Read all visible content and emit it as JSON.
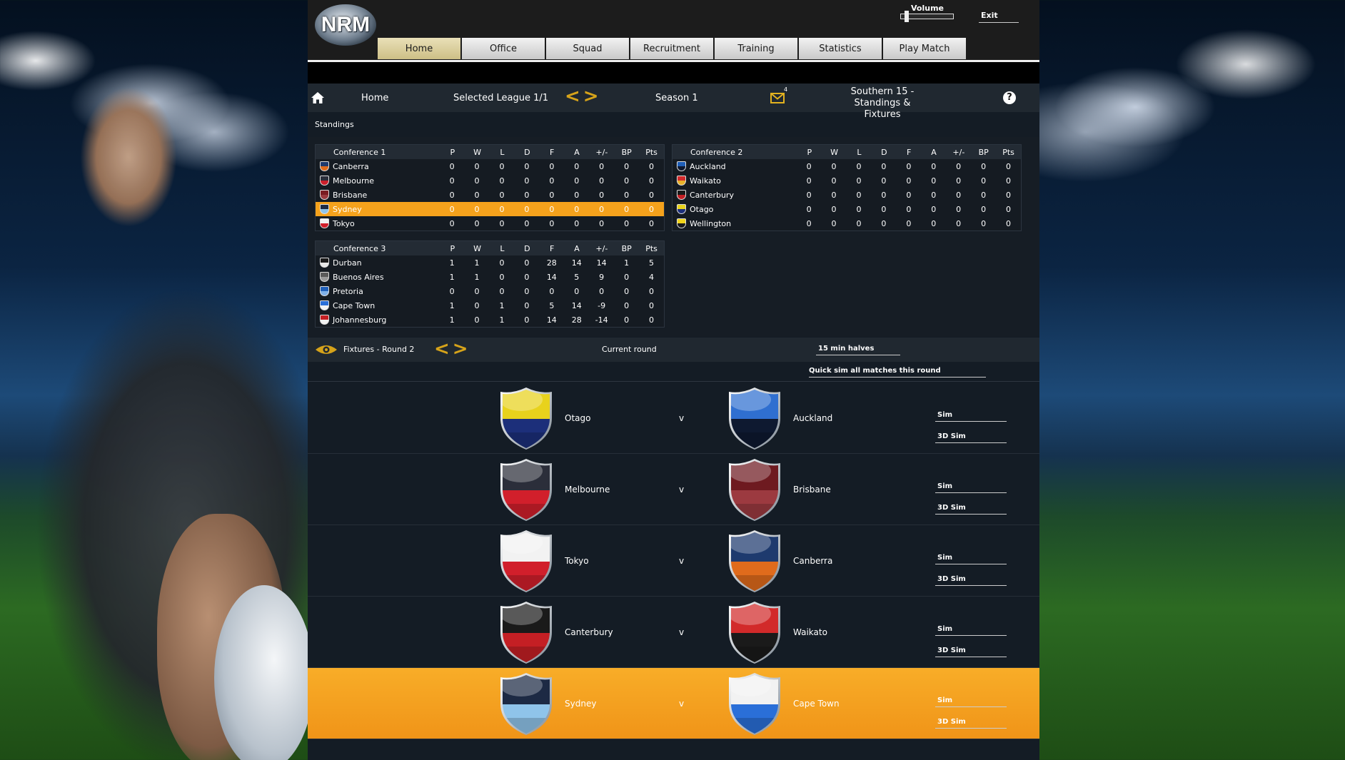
{
  "header": {
    "logo_text": "NRM",
    "volume_label": "Volume",
    "volume_level": 0.12,
    "exit_label": "Exit"
  },
  "tabs": [
    {
      "label": "Home",
      "active": true
    },
    {
      "label": "Office",
      "active": false
    },
    {
      "label": "Squad",
      "active": false
    },
    {
      "label": "Recruitment",
      "active": false
    },
    {
      "label": "Training",
      "active": false
    },
    {
      "label": "Statistics",
      "active": false
    },
    {
      "label": "Play Match",
      "active": false
    }
  ],
  "infobar": {
    "home_label": "Home",
    "league_label": "Selected League 1/1",
    "season_label": "Season 1",
    "mail_count": "4",
    "page_title": "Southern 15 - Standings & Fixtures",
    "help_label": "?"
  },
  "standings": {
    "label": "Standings",
    "columns": [
      "P",
      "W",
      "L",
      "D",
      "F",
      "A",
      "+/-",
      "BP",
      "Pts"
    ],
    "conferences": [
      {
        "name": "Conference 1",
        "rows": [
          {
            "team": "Canberra",
            "colors": [
              "#1e3a6e",
              "#e06b1c"
            ],
            "stats": [
              "0",
              "0",
              "0",
              "0",
              "0",
              "0",
              "0",
              "0",
              "0"
            ],
            "highlight": false
          },
          {
            "team": "Melbourne",
            "colors": [
              "#2b2e3a",
              "#cc1f2b"
            ],
            "stats": [
              "0",
              "0",
              "0",
              "0",
              "0",
              "0",
              "0",
              "0",
              "0"
            ],
            "highlight": false
          },
          {
            "team": "Brisbane",
            "colors": [
              "#7a1c22",
              "#9a3a3f"
            ],
            "stats": [
              "0",
              "0",
              "0",
              "0",
              "0",
              "0",
              "0",
              "0",
              "0"
            ],
            "highlight": false
          },
          {
            "team": "Sydney",
            "colors": [
              "#1d2a44",
              "#8fc4ea"
            ],
            "stats": [
              "0",
              "0",
              "0",
              "0",
              "0",
              "0",
              "0",
              "0",
              "0"
            ],
            "highlight": true
          },
          {
            "team": "Tokyo",
            "colors": [
              "#f2f2f2",
              "#d11f2b"
            ],
            "stats": [
              "0",
              "0",
              "0",
              "0",
              "0",
              "0",
              "0",
              "0",
              "0"
            ],
            "highlight": false
          }
        ]
      },
      {
        "name": "Conference 2",
        "rows": [
          {
            "team": "Auckland",
            "colors": [
              "#1f5fb8",
              "#0e1930"
            ],
            "stats": [
              "0",
              "0",
              "0",
              "0",
              "0",
              "0",
              "0",
              "0",
              "0"
            ],
            "highlight": false
          },
          {
            "team": "Waikato",
            "colors": [
              "#d22a2a",
              "#e8b22a"
            ],
            "stats": [
              "0",
              "0",
              "0",
              "0",
              "0",
              "0",
              "0",
              "0",
              "0"
            ],
            "highlight": false
          },
          {
            "team": "Canterbury",
            "colors": [
              "#1a1a1a",
              "#c41f24"
            ],
            "stats": [
              "0",
              "0",
              "0",
              "0",
              "0",
              "0",
              "0",
              "0",
              "0"
            ],
            "highlight": false
          },
          {
            "team": "Otago",
            "colors": [
              "#e8d21c",
              "#1c2f7a"
            ],
            "stats": [
              "0",
              "0",
              "0",
              "0",
              "0",
              "0",
              "0",
              "0",
              "0"
            ],
            "highlight": false
          },
          {
            "team": "Wellington",
            "colors": [
              "#f0d41a",
              "#1a1a1a"
            ],
            "stats": [
              "0",
              "0",
              "0",
              "0",
              "0",
              "0",
              "0",
              "0",
              "0"
            ],
            "highlight": false
          }
        ]
      },
      {
        "name": "Conference 3",
        "rows": [
          {
            "team": "Durban",
            "colors": [
              "#1a1a1a",
              "#e8e8e8"
            ],
            "stats": [
              "1",
              "1",
              "0",
              "0",
              "28",
              "14",
              "14",
              "1",
              "5"
            ],
            "highlight": false
          },
          {
            "team": "Buenos Aires",
            "colors": [
              "#5a5a5a",
              "#9a9a9a"
            ],
            "stats": [
              "1",
              "1",
              "0",
              "0",
              "14",
              "5",
              "9",
              "0",
              "4"
            ],
            "highlight": false
          },
          {
            "team": "Pretoria",
            "colors": [
              "#1f5fb8",
              "#7fb0e8"
            ],
            "stats": [
              "0",
              "0",
              "0",
              "0",
              "0",
              "0",
              "0",
              "0",
              "0"
            ],
            "highlight": false
          },
          {
            "team": "Cape Town",
            "colors": [
              "#2a6fd8",
              "#f2f2f2"
            ],
            "stats": [
              "1",
              "0",
              "1",
              "0",
              "5",
              "14",
              "-9",
              "0",
              "0"
            ],
            "highlight": false
          },
          {
            "team": "Johannesburg",
            "colors": [
              "#c41f24",
              "#f2f2f2"
            ],
            "stats": [
              "1",
              "0",
              "1",
              "0",
              "14",
              "28",
              "-14",
              "0",
              "0"
            ],
            "highlight": false
          }
        ]
      }
    ]
  },
  "fixtures": {
    "label": "Fixtures - Round 2",
    "current_round_label": "Current round",
    "halves_label": "15 min halves",
    "quick_sim_label": "Quick sim all matches this round",
    "vs_label": "v",
    "sim_label": "Sim",
    "sim3d_label": "3D Sim",
    "matches": [
      {
        "home": "Otago",
        "away": "Auckland",
        "home_colors": [
          "#e8d21c",
          "#1c2f7a"
        ],
        "away_colors": [
          "#2f6fd0",
          "#0e1930"
        ],
        "highlight": false
      },
      {
        "home": "Melbourne",
        "away": "Brisbane",
        "home_colors": [
          "#2b2e3a",
          "#d11f2b"
        ],
        "away_colors": [
          "#6e1a20",
          "#9c3a40"
        ],
        "highlight": false
      },
      {
        "home": "Tokyo",
        "away": "Canberra",
        "home_colors": [
          "#f2f2f2",
          "#d11f2b"
        ],
        "away_colors": [
          "#1e3a6e",
          "#e06b1c"
        ],
        "highlight": false
      },
      {
        "home": "Canterbury",
        "away": "Waikato",
        "home_colors": [
          "#1a1a1a",
          "#c41f24"
        ],
        "away_colors": [
          "#d22a2a",
          "#1a1a1a"
        ],
        "highlight": false
      },
      {
        "home": "Sydney",
        "away": "Cape Town",
        "home_colors": [
          "#1d2a44",
          "#8fc4ea"
        ],
        "away_colors": [
          "#f2f2f2",
          "#2a6fd8"
        ],
        "highlight": true
      }
    ]
  },
  "colors": {
    "accent": "#f5a21c",
    "arrow": "#d6a31a"
  }
}
